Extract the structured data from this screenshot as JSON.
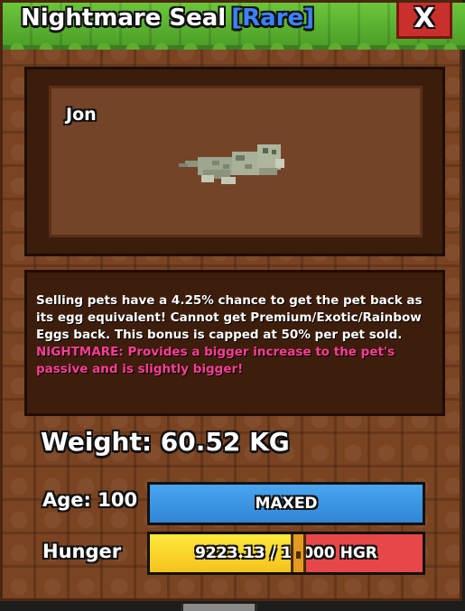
{
  "title": {
    "pet_type": "Nightmare Seal",
    "rarity": "[Rare]"
  },
  "close_label": "X",
  "pet": {
    "name": "Jon"
  },
  "description": {
    "main": "Selling pets have a 4.25% chance to get the pet back as its egg equivalent! Cannot get Premium/Exotic/Rainbow Eggs back. This bonus is capped at 50% per pet sold.",
    "nightmare": "NIGHTMARE: Provides a bigger increase to the pet's passive and is slightly bigger!"
  },
  "stats": {
    "weight": "Weight: 60.52 KG",
    "age_label": "Age: 100",
    "age_bar_text": "MAXED",
    "hunger_label": "Hunger",
    "hunger_bar_text": "9223.13 / 17000 HGR",
    "hunger_value": 9223.13,
    "hunger_max": 17000
  },
  "colors": {
    "rarity": "#3d82ff",
    "nightmare_text": "#ff3d97",
    "title_bar": "#56ae2e",
    "close_button": "#c9302c",
    "age_bar": "#3a96e4",
    "hunger_fill": "#f4d22c",
    "hunger_empty": "#e8474a"
  }
}
